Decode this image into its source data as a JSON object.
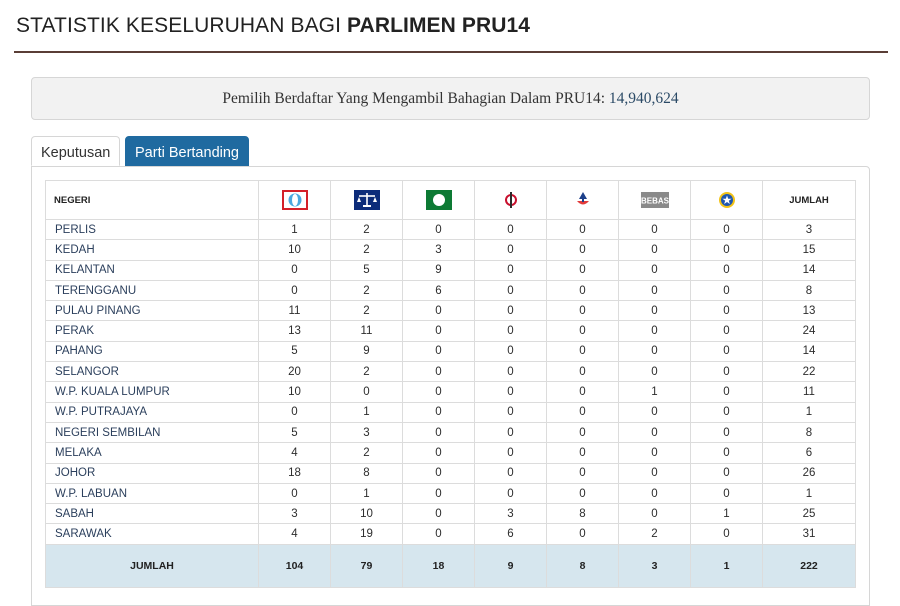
{
  "header": {
    "title_prefix": "STATISTIK KESELURUHAN BAGI",
    "title_bold": "PARLIMEN PRU14"
  },
  "voters": {
    "label": "Pemilih Berdaftar Yang Mengambil Bahagian Dalam PRU14:",
    "value": "14,940,624"
  },
  "tabs": [
    {
      "label": "Keputusan",
      "active": true
    },
    {
      "label": "Parti Bertanding",
      "active": false
    }
  ],
  "table": {
    "state_header": "NEGERI",
    "total_header": "JUMLAH",
    "parties": [
      {
        "icon": "pakatan-harapan-logo-icon"
      },
      {
        "icon": "barisan-nasional-logo-icon"
      },
      {
        "icon": "pas-logo-icon"
      },
      {
        "icon": "dap-logo-icon"
      },
      {
        "icon": "warisan-logo-icon"
      },
      {
        "icon": "bebas-logo-icon",
        "text": "BEBAS"
      },
      {
        "icon": "star-party-logo-icon"
      }
    ],
    "rows": [
      {
        "state": "PERLIS",
        "values": [
          "1",
          "2",
          "0",
          "0",
          "0",
          "0",
          "0"
        ],
        "total": "3"
      },
      {
        "state": "KEDAH",
        "values": [
          "10",
          "2",
          "3",
          "0",
          "0",
          "0",
          "0"
        ],
        "total": "15"
      },
      {
        "state": "KELANTAN",
        "values": [
          "0",
          "5",
          "9",
          "0",
          "0",
          "0",
          "0"
        ],
        "total": "14"
      },
      {
        "state": "TERENGGANU",
        "values": [
          "0",
          "2",
          "6",
          "0",
          "0",
          "0",
          "0"
        ],
        "total": "8"
      },
      {
        "state": "PULAU PINANG",
        "values": [
          "11",
          "2",
          "0",
          "0",
          "0",
          "0",
          "0"
        ],
        "total": "13"
      },
      {
        "state": "PERAK",
        "values": [
          "13",
          "11",
          "0",
          "0",
          "0",
          "0",
          "0"
        ],
        "total": "24"
      },
      {
        "state": "PAHANG",
        "values": [
          "5",
          "9",
          "0",
          "0",
          "0",
          "0",
          "0"
        ],
        "total": "14"
      },
      {
        "state": "SELANGOR",
        "values": [
          "20",
          "2",
          "0",
          "0",
          "0",
          "0",
          "0"
        ],
        "total": "22"
      },
      {
        "state": "W.P. KUALA LUMPUR",
        "values": [
          "10",
          "0",
          "0",
          "0",
          "0",
          "1",
          "0"
        ],
        "total": "11"
      },
      {
        "state": "W.P. PUTRAJAYA",
        "values": [
          "0",
          "1",
          "0",
          "0",
          "0",
          "0",
          "0"
        ],
        "total": "1"
      },
      {
        "state": "NEGERI SEMBILAN",
        "values": [
          "5",
          "3",
          "0",
          "0",
          "0",
          "0",
          "0"
        ],
        "total": "8"
      },
      {
        "state": "MELAKA",
        "values": [
          "4",
          "2",
          "0",
          "0",
          "0",
          "0",
          "0"
        ],
        "total": "6"
      },
      {
        "state": "JOHOR",
        "values": [
          "18",
          "8",
          "0",
          "0",
          "0",
          "0",
          "0"
        ],
        "total": "26"
      },
      {
        "state": "W.P. LABUAN",
        "values": [
          "0",
          "1",
          "0",
          "0",
          "0",
          "0",
          "0"
        ],
        "total": "1"
      },
      {
        "state": "SABAH",
        "values": [
          "3",
          "10",
          "0",
          "3",
          "8",
          "0",
          "1"
        ],
        "total": "25"
      },
      {
        "state": "SARAWAK",
        "values": [
          "4",
          "19",
          "0",
          "6",
          "0",
          "2",
          "0"
        ],
        "total": "31"
      }
    ],
    "footer": {
      "label": "JUMLAH",
      "values": [
        "104",
        "79",
        "18",
        "9",
        "8",
        "3",
        "1"
      ],
      "total": "222"
    }
  }
}
